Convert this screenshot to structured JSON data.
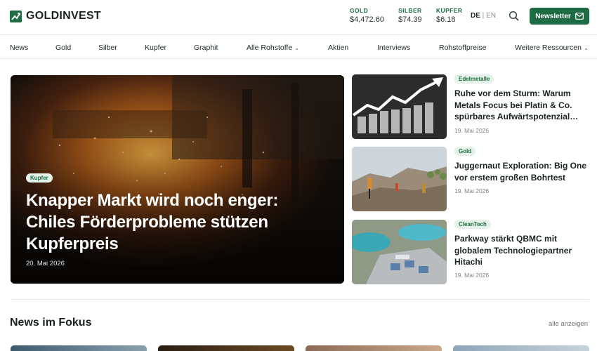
{
  "header": {
    "logo_text": "GOLDINVEST",
    "tickers": [
      {
        "label": "GOLD",
        "value": "$4,472.60"
      },
      {
        "label": "SILBER",
        "value": "$74.39"
      },
      {
        "label": "KUPFER",
        "value": "$6.18"
      }
    ],
    "lang_active": "DE",
    "lang_sep": " | ",
    "lang_other": "EN",
    "newsletter_label": "Newsletter"
  },
  "nav": {
    "items": [
      "News",
      "Gold",
      "Silber",
      "Kupfer",
      "Graphit",
      "Alle Rohstoffe",
      "Aktien",
      "Interviews",
      "Rohstoffpreise",
      "Weitere Ressourcen"
    ]
  },
  "hero": {
    "badge": "Kupfer",
    "title": "Knapper Markt wird noch enger: Chiles Förderprobleme stützen Kupferpreis",
    "date": "20. Mai 2026"
  },
  "side_articles": [
    {
      "badge": "Edelmetalle",
      "title": "Ruhe vor dem Sturm: Warum Metals Focus bei Platin & Co. spürbares Aufwärtspotenzial…",
      "date": "19. Mai 2026"
    },
    {
      "badge": "Gold",
      "title": "Juggernaut Exploration: Big One vor erstem großen Bohrtest",
      "date": "19. Mai 2026"
    },
    {
      "badge": "CleanTech",
      "title": "Parkway stärkt QBMC mit globalem Technologiepartner Hitachi",
      "date": "19. Mai 2026"
    }
  ],
  "focus": {
    "title": "News im Fokus",
    "show_all": "alle anzeigen"
  },
  "colors": {
    "brand_green": "#1f6b43",
    "badge_bg": "#e3f1e6"
  }
}
